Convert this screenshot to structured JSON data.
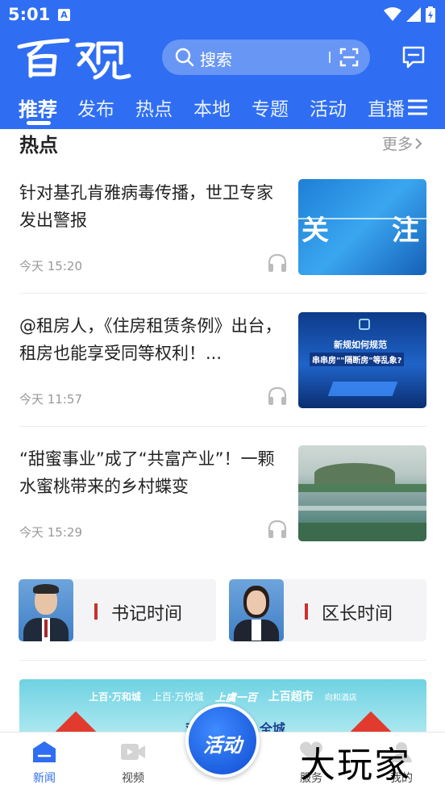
{
  "status": {
    "time": "5:01",
    "notif_letter": "A"
  },
  "header": {
    "logo_text": "百观",
    "search_placeholder": "搜索",
    "tabs": [
      "推荐",
      "发布",
      "热点",
      "本地",
      "专题",
      "活动",
      "直播"
    ],
    "active_tab": "推荐"
  },
  "section": {
    "title": "热点",
    "more": "更多"
  },
  "news": [
    {
      "title": "针对基孔肯雅病毒传播，世卫专家发出警报",
      "time": "今天 15:20",
      "thumb_text": [
        "关",
        "注"
      ]
    },
    {
      "title": "@租房人，《住房租赁条例》出台，租房也能享受同等权利！...",
      "time": "今天 11:57",
      "thumb_text": [
        "新规如何规范",
        "串串房\"\"隔断房\"等乱象?"
      ]
    },
    {
      "title": "“甜蜜事业”成了“共富产业”！一颗水蜜桃带来的乡村蝶变",
      "time": "今天 15:29"
    }
  ],
  "cards": [
    {
      "label": "书记时间"
    },
    {
      "label": "区长时间"
    }
  ],
  "banner": {
    "brands": [
      "上百·万和城",
      "上百·万悦城",
      "上虞一百",
      "上百超市",
      "向和酒店"
    ],
    "line2": "双百",
    "line2b": "全城"
  },
  "bottom_nav": {
    "items": [
      {
        "label": "新闻",
        "icon": "news-icon"
      },
      {
        "label": "视频",
        "icon": "video-icon"
      },
      {
        "label": "服务",
        "icon": "heart-icon"
      },
      {
        "label": "我的",
        "icon": "user-icon"
      }
    ],
    "center_label": "活动"
  },
  "watermark": "大玩家",
  "colors": {
    "primary": "#2f6ef2",
    "accent_red": "#c9302c"
  }
}
